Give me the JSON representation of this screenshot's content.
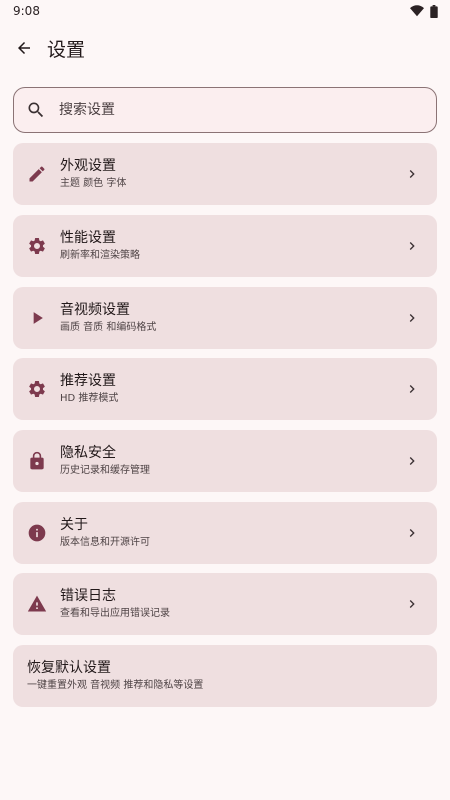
{
  "status": {
    "time": "9:08",
    "wifi_icon": "wifi-icon",
    "battery_icon": "battery-icon"
  },
  "header": {
    "title": "设置",
    "back_icon": "arrow-back-icon"
  },
  "search": {
    "placeholder": "搜索设置",
    "value": ""
  },
  "items": [
    {
      "icon": "pencil-icon",
      "title": "外观设置",
      "subtitle": "主题 颜色 字体"
    },
    {
      "icon": "gear-icon",
      "title": "性能设置",
      "subtitle": "刷新率和渲染策略"
    },
    {
      "icon": "play-icon",
      "title": "音视频设置",
      "subtitle": "画质 音质 和编码格式"
    },
    {
      "icon": "gear-icon",
      "title": "推荐设置",
      "subtitle": "HD 推荐模式"
    },
    {
      "icon": "lock-icon",
      "title": "隐私安全",
      "subtitle": "历史记录和缓存管理"
    },
    {
      "icon": "info-icon",
      "title": "关于",
      "subtitle": "版本信息和开源许可"
    },
    {
      "icon": "warning-icon",
      "title": "错误日志",
      "subtitle": "查看和导出应用错误记录"
    }
  ],
  "reset": {
    "title": "恢复默认设置",
    "subtitle": "一键重置外观 音视频 推荐和隐私等设置"
  },
  "colors": {
    "accent": "#7d3a4e",
    "card": "#efdfe0",
    "background": "#fdf7f7"
  }
}
